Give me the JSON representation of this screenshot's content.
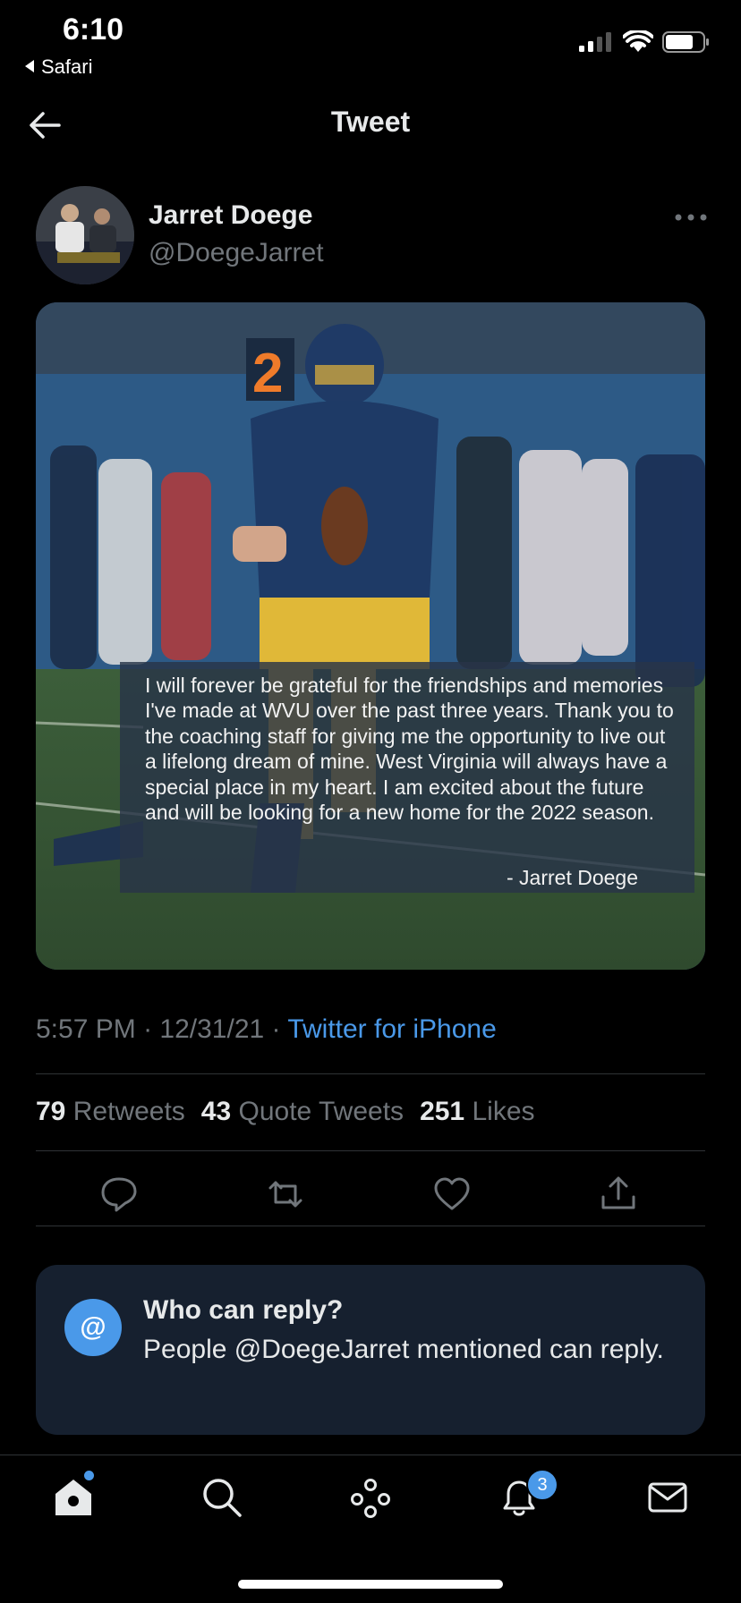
{
  "status_bar": {
    "time": "6:10",
    "back_app": "Safari"
  },
  "header": {
    "title": "Tweet"
  },
  "tweet": {
    "author_name": "Jarret Doege",
    "author_handle": "@DoegeJarret",
    "image_quote": "I will forever be grateful for the friendships and memories I've made at WVU over the past three years. Thank you to the coaching staff for giving me the opportunity to live out a lifelong dream of mine. West Virginia will always have a special place in my heart. I am excited about the future and will be looking for a new home for the 2022 season.",
    "image_signature": "- Jarret Doege",
    "jersey_number": "2",
    "time": "5:57 PM",
    "date": "12/31/21",
    "source": "Twitter for iPhone",
    "separator": " · "
  },
  "stats": {
    "retweets_count": "79",
    "retweets_label": "Retweets",
    "quotes_count": "43",
    "quotes_label": "Quote Tweets",
    "likes_count": "251",
    "likes_label": "Likes"
  },
  "reply_card": {
    "icon_text": "@",
    "title": "Who can reply?",
    "text": "People @DoegeJarret mentioned can reply."
  },
  "tab_bar": {
    "notifications_badge": "3"
  },
  "colors": {
    "accent": "#4a99e9",
    "background": "#000000",
    "card": "#16202f",
    "muted": "#71767b"
  }
}
